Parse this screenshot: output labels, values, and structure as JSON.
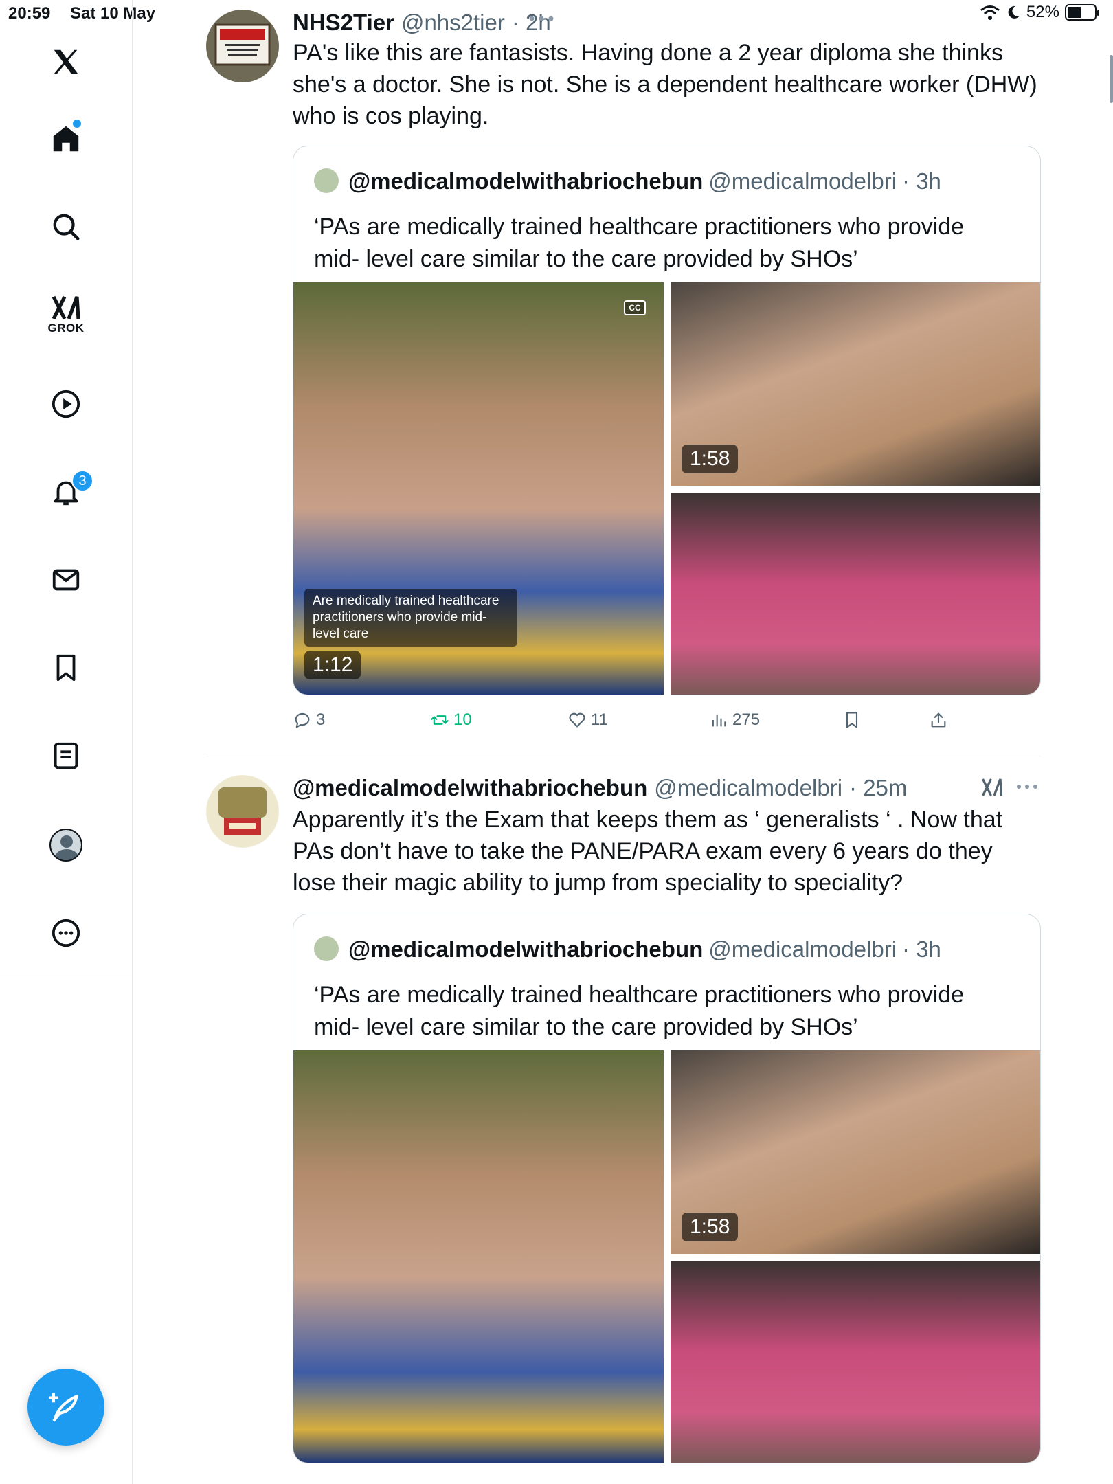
{
  "status_bar": {
    "time": "20:59",
    "date": "Sat 10 May",
    "battery": "52%"
  },
  "sidebar": {
    "grok_label": "GROK",
    "notifications_badge": "3"
  },
  "tweets": [
    {
      "name": "NHS2Tier",
      "handle": "@nhs2tier",
      "time": "· 2h",
      "text": "PA's like this are fantasists. Having done a 2 year diploma she thinks she's a doctor. She is not. She is a dependent healthcare worker (DHW) who is cos playing.",
      "quote": {
        "name": "@medicalmodelwithabriochebun",
        "handle": "@medicalmodelbri",
        "time": "· 3h",
        "text": "‘PAs are medically trained healthcare practitioners who provide mid- level care similar to the care provided by SHOs’",
        "video1_duration": "1:12",
        "video1_caption": "Are medically trained healthcare practitioners who provide mid-level care",
        "video2_duration": "1:58",
        "cc_label": "CC"
      },
      "replies": "3",
      "reposts": "10",
      "likes": "11",
      "views": "275"
    },
    {
      "name": "@medicalmodelwithabriochebun",
      "handle": "@medicalmodelbri",
      "time": "· 25m",
      "text": "Apparently it’s the Exam that keeps them as ‘ generalists ‘ . Now that PAs don’t have to take the PANE/PARA  exam every 6 years do they lose their magic ability to jump from speciality to speciality?",
      "quote": {
        "name": "@medicalmodelwithabriochebun",
        "handle": "@medicalmodelbri",
        "time": "· 3h",
        "text": "‘PAs are medically trained healthcare practitioners who provide mid- level care similar to the care provided by SHOs’",
        "video2_duration": "1:58"
      }
    }
  ],
  "colors": {
    "accent": "#1d9bf0",
    "repost_green": "#00ba7c",
    "muted": "#536471"
  }
}
